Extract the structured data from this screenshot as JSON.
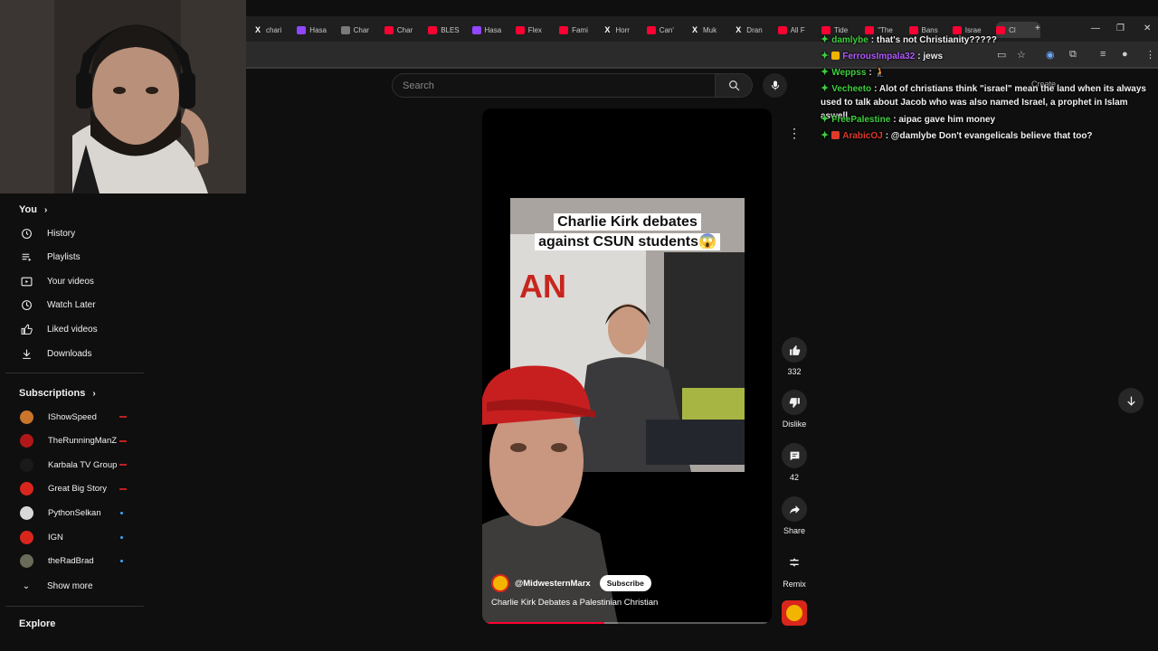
{
  "browser": {
    "tabs": [
      {
        "label": "chari",
        "icon": "x-favicon"
      },
      {
        "label": "Hasa",
        "icon": "twitch-favicon"
      },
      {
        "label": "Char",
        "icon": "generic-favicon"
      },
      {
        "label": "Char",
        "icon": "youtube-favicon"
      },
      {
        "label": "BLES",
        "icon": "youtube-favicon"
      },
      {
        "label": "Hasa",
        "icon": "twitch-favicon"
      },
      {
        "label": "Flex",
        "icon": "youtube-favicon"
      },
      {
        "label": "Fami",
        "icon": "youtube-favicon"
      },
      {
        "label": "Horr",
        "icon": "x-favicon"
      },
      {
        "label": "Can'",
        "icon": "youtube-favicon"
      },
      {
        "label": "Muk",
        "icon": "x-favicon"
      },
      {
        "label": "Dran",
        "icon": "x-favicon"
      },
      {
        "label": "All F",
        "icon": "youtube-favicon"
      },
      {
        "label": "Tide",
        "icon": "youtube-favicon"
      },
      {
        "label": "\"The",
        "icon": "youtube-favicon"
      },
      {
        "label": "Bans",
        "icon": "youtube-favicon"
      },
      {
        "label": "Israe",
        "icon": "youtube-favicon"
      },
      {
        "label": "Cl",
        "icon": "youtube-favicon"
      }
    ],
    "new_tab": "+",
    "minimize": "—",
    "restore": "❐",
    "close": "✕"
  },
  "header": {
    "search_placeholder": "Search",
    "create_label": "Create"
  },
  "sidebar": {
    "you_label": "You",
    "you_items": [
      {
        "label": "History",
        "icon": "history-icon"
      },
      {
        "label": "Playlists",
        "icon": "playlists-icon"
      },
      {
        "label": "Your videos",
        "icon": "your-videos-icon"
      },
      {
        "label": "Watch Later",
        "icon": "watch-later-icon"
      },
      {
        "label": "Liked videos",
        "icon": "liked-videos-icon"
      },
      {
        "label": "Downloads",
        "icon": "downloads-icon"
      }
    ],
    "subscriptions_label": "Subscriptions",
    "subscriptions": [
      {
        "name": "IShowSpeed",
        "status": "live",
        "color": "#c9752b"
      },
      {
        "name": "TheRunningManZ",
        "status": "live",
        "color": "#b01818"
      },
      {
        "name": "Karbala TV Group",
        "status": "live",
        "color": "#1a1a1a"
      },
      {
        "name": "Great Big Story",
        "status": "live",
        "color": "#d9261c"
      },
      {
        "name": "PythonSelkan",
        "status": "new",
        "color": "#d8d8d8"
      },
      {
        "name": "IGN",
        "status": "new",
        "color": "#d9261c"
      },
      {
        "name": "theRadBrad",
        "status": "new",
        "color": "#6b6b5a"
      }
    ],
    "show_more_label": "Show more",
    "explore_label": "Explore"
  },
  "video": {
    "caption_line1": "Charlie Kirk debates",
    "caption_line2": "against CSUN students😱",
    "channel": "@MidwesternMarx",
    "subscribe_label": "Subscribe",
    "title": "Charlie Kirk Debates a Palestinian Christian",
    "progress": 0.42
  },
  "actions": {
    "likes": "332",
    "dislike_label": "Dislike",
    "comments": "42",
    "share_label": "Share",
    "remix_label": "Remix"
  },
  "chat": [
    {
      "user": "damlybe",
      "user_color": "#3ecf3e",
      "text": ": that's not Christianity?????",
      "badge": "green-diamond"
    },
    {
      "user": "FerrousImpala32",
      "user_color": "#b25bff",
      "text": ": jews",
      "badge": "green-diamond-sub"
    },
    {
      "user": "Weppss",
      "user_color": "#3ecf3e",
      "text": ": 🧎",
      "badge": "green-diamond"
    },
    {
      "user": "Vecheeto",
      "user_color": "#3ecf3e",
      "text": ": Alot of christians think \"israel\" mean the land when its always used to talk about Jacob who was also named Israel, a prophet in Islam aswell",
      "badge": "green-diamond"
    },
    {
      "user": "FreePalestine",
      "user_color": "#3ecf3e",
      "text": ": aipac gave him money",
      "badge": "green-diamond"
    },
    {
      "user": "ArabicOJ",
      "user_color": "#e0392b",
      "text": ": @damlybe Don't evangelicals believe that too?",
      "badge": "green-diamond-warn"
    }
  ]
}
